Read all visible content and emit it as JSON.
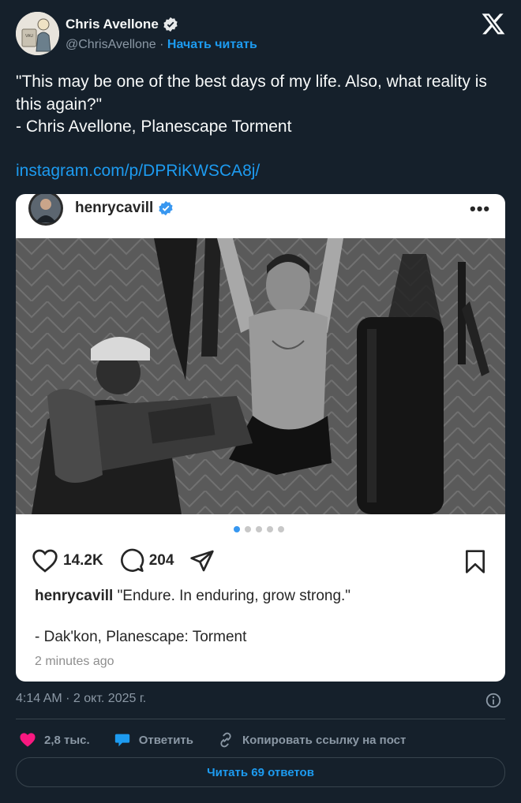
{
  "author": {
    "name": "Chris Avellone",
    "handle": "@ChrisAvellone",
    "separator": "·",
    "follow_label": "Начать читать"
  },
  "tweet": {
    "line1": "\"This may be one of the best days of my life. Also, what reality is this again?\"",
    "line2": "- Chris Avellone, Planescape Torment",
    "link": "instagram.com/p/DPRiKWSCA8j/"
  },
  "instagram": {
    "username": "henrycavill",
    "more_label": "•••",
    "carousel": {
      "count": 5,
      "active": 0
    },
    "likes": "14.2K",
    "comments": "204",
    "caption_user": "henrycavill",
    "caption_text": "\"Endure. In enduring, grow strong.\"",
    "caption_line2": "- Dak'kon, Planescape: Torment",
    "time": "2 minutes ago"
  },
  "footer": {
    "timestamp": "4:14 AM · 2 окт. 2025 г.",
    "likes": "2,8 тыс.",
    "reply_label": "Ответить",
    "copy_label": "Копировать ссылку на пост",
    "read_replies_label": "Читать 69 ответов"
  },
  "colors": {
    "background": "#15202b",
    "accent": "#1d9bf0",
    "like_pink": "#f91880",
    "muted": "#8b98a5",
    "divider": "#38444d"
  }
}
